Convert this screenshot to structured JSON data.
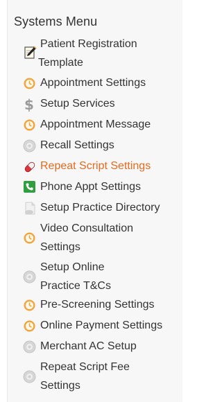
{
  "sidebar": {
    "title": "Systems Menu",
    "items": [
      {
        "label_1": "Patient Registration",
        "label_2": "Template",
        "icon": "pencil-note-icon"
      },
      {
        "label_1": "Appointment Settings",
        "icon": "clock-icon"
      },
      {
        "label_1": "Setup Services",
        "icon": "dollar-icon"
      },
      {
        "label_1": "Appointment Message",
        "icon": "clock-icon"
      },
      {
        "label_1": "Recall Settings",
        "icon": "gear-icon"
      },
      {
        "label_1": "Repeat Script Settings",
        "icon": "pill-icon",
        "active": true
      },
      {
        "label_1": "Phone Appt Settings",
        "icon": "phone-icon"
      },
      {
        "label_1": "Setup Practice Directory",
        "icon": "document-icon"
      },
      {
        "label_1": "Video Consultation",
        "label_2": "Settings",
        "icon": "clock-icon"
      },
      {
        "label_1": "Setup Online",
        "label_2": "Practice T&Cs",
        "icon": "gear-icon"
      },
      {
        "label_1": "Pre-Screening Settings",
        "icon": "clock-icon"
      },
      {
        "label_1": "Online Payment Settings",
        "icon": "clock-icon"
      },
      {
        "label_1": "Merchant AC Setup",
        "icon": "gear-icon"
      },
      {
        "label_1": "Repeat Script Fee",
        "label_2": "Settings",
        "icon": "gear-icon"
      }
    ]
  },
  "colors": {
    "text": "#333333",
    "active_text": "#e86a1f",
    "clock_orange": "#f4a23a",
    "phone_green": "#2e9e3e",
    "pill_red": "#d9363e",
    "gear_gray": "#cfcfcf",
    "panel_bg": "#f7f7f7"
  }
}
